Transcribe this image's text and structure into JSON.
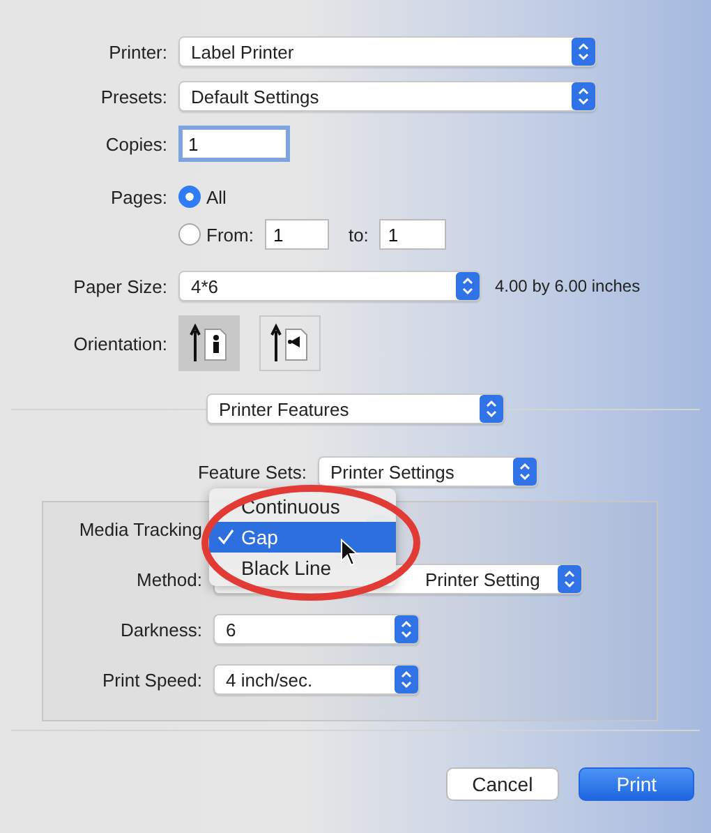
{
  "printer": {
    "label": "Printer:",
    "value": "Label Printer"
  },
  "presets": {
    "label": "Presets:",
    "value": "Default Settings"
  },
  "copies": {
    "label": "Copies:",
    "value": "1"
  },
  "pages": {
    "label": "Pages:",
    "options": [
      {
        "kind": "all",
        "label": "All",
        "selected": true
      },
      {
        "kind": "range",
        "label": "From:",
        "selected": false,
        "from": "1",
        "to_label": "to:",
        "to": "1"
      }
    ]
  },
  "paper_size": {
    "label": "Paper Size:",
    "value": "4*6",
    "note": "4.00 by 6.00 inches"
  },
  "orientation": {
    "label": "Orientation:",
    "options": [
      {
        "kind": "portrait",
        "selected": true
      },
      {
        "kind": "landscape",
        "selected": false
      }
    ]
  },
  "panel": {
    "value": "Printer Features"
  },
  "feature_sets": {
    "label": "Feature Sets:",
    "value": "Printer Settings"
  },
  "settings": [
    {
      "label": "Media Tracking"
    },
    {
      "label": "Method:",
      "value": "Printer Setting"
    },
    {
      "label": "Darkness:",
      "value": "6"
    },
    {
      "label": "Print Speed:",
      "value": "4 inch/sec."
    }
  ],
  "menu": {
    "items": [
      {
        "label": "Continuous",
        "checked": false,
        "selected": false
      },
      {
        "label": "Gap",
        "checked": true,
        "selected": true
      },
      {
        "label": "Black Line",
        "checked": false,
        "selected": false
      }
    ]
  },
  "buttons": [
    {
      "kind": "secondary",
      "label": "Cancel"
    },
    {
      "kind": "default",
      "label": "Print"
    }
  ]
}
